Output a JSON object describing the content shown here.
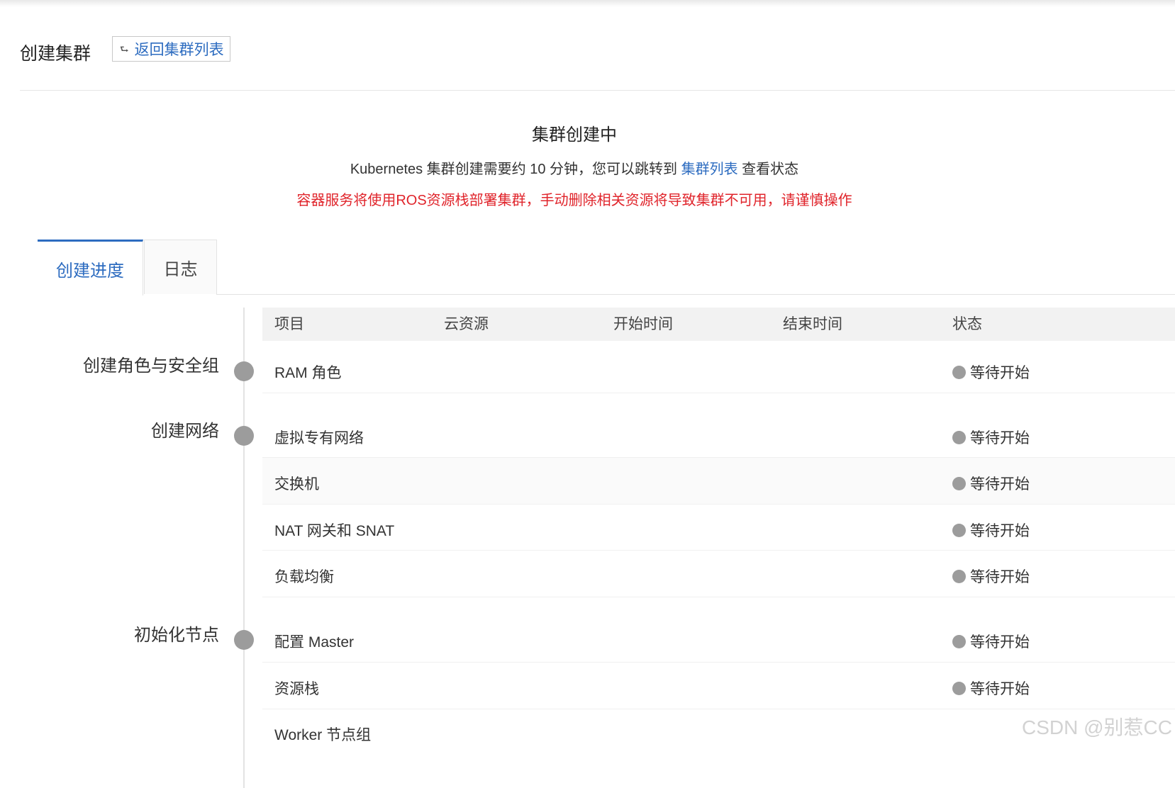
{
  "header": {
    "title": "创建集群",
    "back_button": "返回集群列表",
    "back_icon": "upload-arrow-icon"
  },
  "status": {
    "title": "集群创建中",
    "desc_prefix": "Kubernetes 集群创建需要约 10 分钟，您可以跳转到 ",
    "desc_link": "集群列表",
    "desc_suffix": " 查看状态",
    "warning": "容器服务将使用ROS资源栈部署集群，手动删除相关资源将导致集群不可用，请谨慎操作"
  },
  "tabs": [
    {
      "label": "创建进度",
      "active": true
    },
    {
      "label": "日志",
      "active": false
    }
  ],
  "table": {
    "columns": [
      "项目",
      "云资源",
      "开始时间",
      "结束时间",
      "状态"
    ]
  },
  "stages": [
    {
      "label": "创建角色与安全组"
    },
    {
      "label": "创建网络"
    },
    {
      "label": "初始化节点"
    }
  ],
  "rows": [
    {
      "name": "RAM 角色",
      "status": "等待开始"
    },
    {
      "name": "虚拟专有网络",
      "status": "等待开始"
    },
    {
      "name": "交换机",
      "status": "等待开始"
    },
    {
      "name": "NAT 网关和 SNAT",
      "status": "等待开始"
    },
    {
      "name": "负载均衡",
      "status": "等待开始"
    },
    {
      "name": "配置 Master",
      "status": "等待开始"
    },
    {
      "name": "资源栈",
      "status": "等待开始"
    },
    {
      "name": "Worker 节点组",
      "status": ""
    }
  ],
  "watermark": "CSDN @别惹CC",
  "colors": {
    "link": "#2d6cc0",
    "warning": "#e0242b",
    "dot": "#9c9c9c"
  }
}
